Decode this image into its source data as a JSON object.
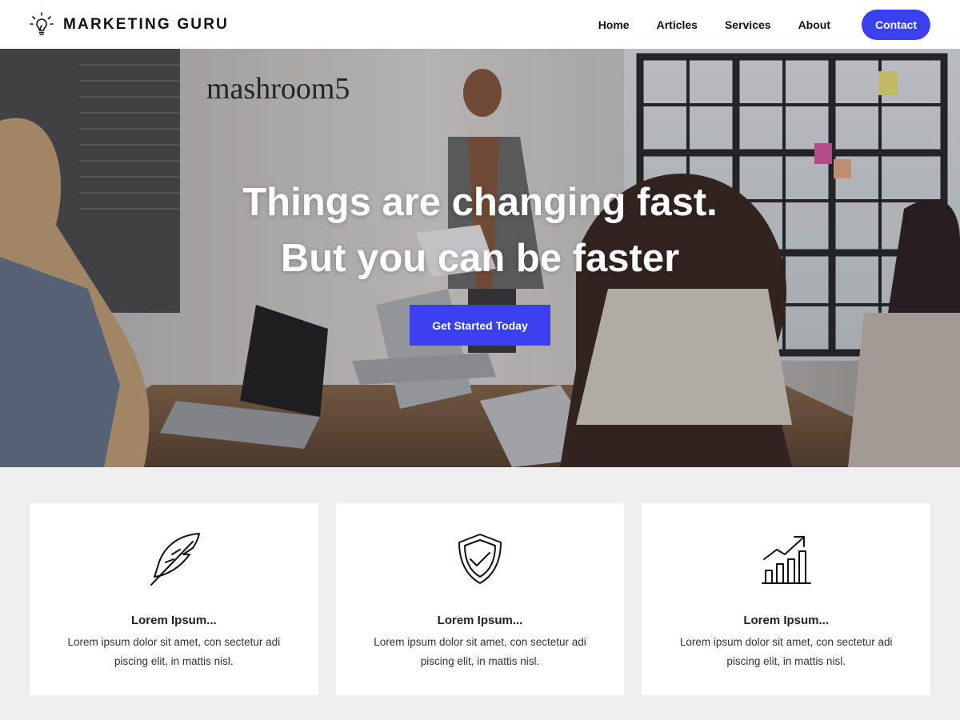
{
  "header": {
    "brand": "MARKETING GURU",
    "brand_icon": "lightbulb-icon",
    "nav": [
      "Home",
      "Articles",
      "Services",
      "About"
    ],
    "contact_label": "Contact"
  },
  "hero": {
    "headline_line1": "Things are changing fast.",
    "headline_line2": "But you can be faster",
    "cta_label": "Get Started Today",
    "photo_sign_text": "mashroom5"
  },
  "features": [
    {
      "icon": "feather-icon",
      "title": "Lorem Ipsum...",
      "text": "Lorem ipsum dolor sit amet, con sectetur adi piscing elit, in mattis nisl."
    },
    {
      "icon": "shield-check-icon",
      "title": "Lorem Ipsum...",
      "text": "Lorem ipsum dolor sit amet, con sectetur adi piscing elit, in mattis nisl."
    },
    {
      "icon": "growth-chart-icon",
      "title": "Lorem Ipsum...",
      "text": "Lorem ipsum dolor sit amet, con sectetur adi piscing elit, in mattis nisl."
    }
  ],
  "colors": {
    "accent": "#3b40ee",
    "page_bg": "#efefef",
    "card_bg": "#ffffff"
  }
}
